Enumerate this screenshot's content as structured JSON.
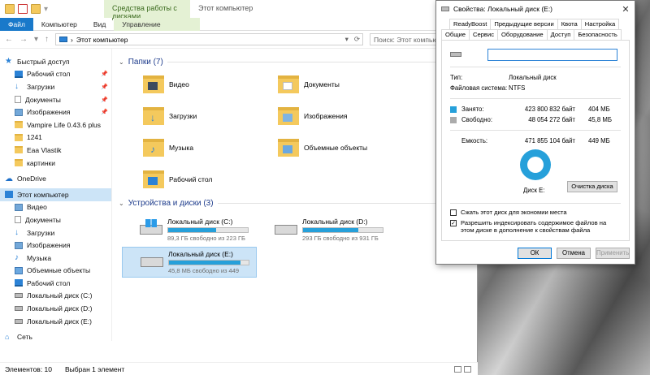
{
  "explorer": {
    "context_tab": "Средства работы с дисками",
    "window_title": "Этот компьютер",
    "ribbon": [
      "Файл",
      "Компьютер",
      "Вид",
      "Управление"
    ],
    "path": "Этот компьютер",
    "search_placeholder": "Поиск: Этот компьютер",
    "sidebar": [
      {
        "label": "Быстрый доступ",
        "icon": "star-icon",
        "level": 1,
        "pinned": false
      },
      {
        "label": "Рабочий стол",
        "icon": "desktop-icon",
        "level": 2,
        "pinned": true
      },
      {
        "label": "Загрузки",
        "icon": "download-icon",
        "level": 2,
        "pinned": true
      },
      {
        "label": "Документы",
        "icon": "document-icon",
        "level": 2,
        "pinned": true
      },
      {
        "label": "Изображения",
        "icon": "image-icon",
        "level": 2,
        "pinned": true
      },
      {
        "label": "Vampire Life 0.43.6 plus",
        "icon": "folder-icon",
        "level": 2,
        "pinned": false
      },
      {
        "label": "1241",
        "icon": "folder-icon",
        "level": 2,
        "pinned": false
      },
      {
        "label": "Eaa Vlastik",
        "icon": "folder-icon",
        "level": 2,
        "pinned": false
      },
      {
        "label": "картинки",
        "icon": "folder-icon",
        "level": 2,
        "pinned": false
      },
      {
        "label": "OneDrive",
        "icon": "cloud-icon",
        "level": 1,
        "pinned": false
      },
      {
        "label": "Этот компьютер",
        "icon": "computer-icon",
        "level": 1,
        "pinned": false,
        "selected": true
      },
      {
        "label": "Видео",
        "icon": "video-icon",
        "level": 2,
        "pinned": false
      },
      {
        "label": "Документы",
        "icon": "document-icon",
        "level": 2,
        "pinned": false
      },
      {
        "label": "Загрузки",
        "icon": "download-icon",
        "level": 2,
        "pinned": false
      },
      {
        "label": "Изображения",
        "icon": "image-icon",
        "level": 2,
        "pinned": false
      },
      {
        "label": "Музыка",
        "icon": "music-icon",
        "level": 2,
        "pinned": false
      },
      {
        "label": "Объемные объекты",
        "icon": "cube-icon",
        "level": 2,
        "pinned": false
      },
      {
        "label": "Рабочий стол",
        "icon": "desktop-icon",
        "level": 2,
        "pinned": false
      },
      {
        "label": "Локальный диск (C:)",
        "icon": "drive-icon",
        "level": 2,
        "pinned": false
      },
      {
        "label": "Локальный диск (D:)",
        "icon": "drive-icon",
        "level": 2,
        "pinned": false
      },
      {
        "label": "Локальный диск (E:)",
        "icon": "drive-icon",
        "level": 2,
        "pinned": false
      },
      {
        "label": "Сеть",
        "icon": "network-icon",
        "level": 1,
        "pinned": false
      }
    ],
    "folders_header": "Папки (7)",
    "folders": [
      {
        "label": "Видео",
        "icon": "video-icon"
      },
      {
        "label": "Документы",
        "icon": "document-icon"
      },
      {
        "label": "Загрузки",
        "icon": "download-icon"
      },
      {
        "label": "Изображения",
        "icon": "image-icon"
      },
      {
        "label": "Музыка",
        "icon": "music-icon"
      },
      {
        "label": "Объемные объекты",
        "icon": "cube-icon"
      },
      {
        "label": "Рабочий стол",
        "icon": "desktop-icon"
      }
    ],
    "drives_header": "Устройства и диски (3)",
    "drives": [
      {
        "name": "Локальный диск (C:)",
        "free": "89,3 ГБ свободно из 223 ГБ",
        "used_fraction": 0.6,
        "system": true
      },
      {
        "name": "Локальный диск (D:)",
        "free": "293 ГБ свободно из 931 ГБ",
        "used_fraction": 0.69,
        "system": false
      },
      {
        "name": "Локальный диск (E:)",
        "free": "45,8 МБ свободно из 449",
        "used_fraction": 0.9,
        "system": false,
        "selected": true
      }
    ],
    "status": {
      "items": "Элементов: 10",
      "selected": "Выбран 1 элемент"
    }
  },
  "dialog": {
    "title": "Свойства: Локальный диск (E:)",
    "tabs_row1": [
      "ReadyBoost",
      "Предыдущие версии",
      "Квота",
      "Настройка"
    ],
    "tabs_row2": [
      "Общие",
      "Сервис",
      "Оборудование",
      "Доступ",
      "Безопасность"
    ],
    "type_label": "Тип:",
    "type_value": "Локальный диск",
    "fs_label": "Файловая система:",
    "fs_value": "NTFS",
    "used_label": "Занято:",
    "used_bytes": "423 800 832 байт",
    "used_size": "404 МБ",
    "free_label": "Свободно:",
    "free_bytes": "48 054 272 байт",
    "free_size": "45,8 МБ",
    "cap_label": "Емкость:",
    "cap_bytes": "471 855 104 байт",
    "cap_size": "449 МБ",
    "disk_label": "Диск E:",
    "cleanup": "Очистка диска",
    "compress": "Сжать этот диск для экономии места",
    "index": "Разрешить индексировать содержимое файлов на этом диске в дополнение к свойствам файла",
    "ok": "ОК",
    "cancel": "Отмена",
    "apply": "Применить"
  }
}
